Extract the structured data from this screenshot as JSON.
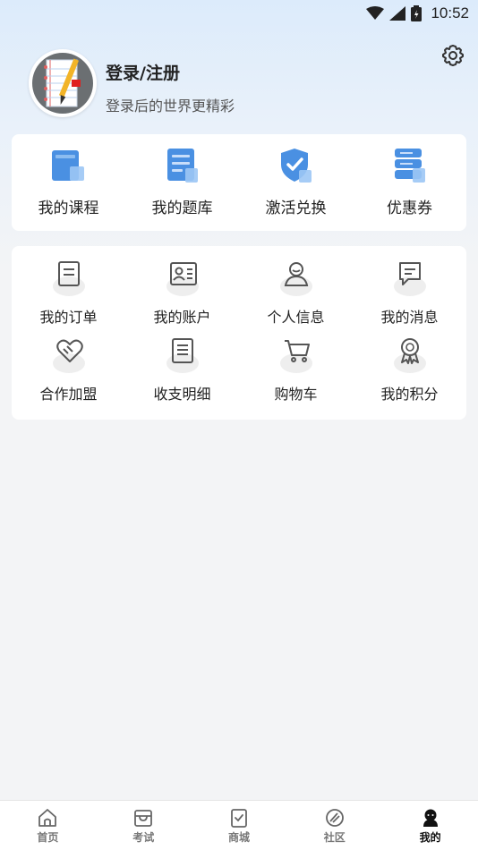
{
  "status_bar": {
    "time": "10:52"
  },
  "profile": {
    "title": "登录/注册",
    "subtitle": "登录后的世界更精彩"
  },
  "top_menu": [
    {
      "label": "我的课程",
      "icon": "course-icon"
    },
    {
      "label": "我的题库",
      "icon": "question-bank-icon"
    },
    {
      "label": "激活兑换",
      "icon": "shield-check-icon"
    },
    {
      "label": "优惠券",
      "icon": "coupon-icon"
    }
  ],
  "grid_menu": [
    {
      "label": "我的订单",
      "icon": "order-icon"
    },
    {
      "label": "我的账户",
      "icon": "account-card-icon"
    },
    {
      "label": "个人信息",
      "icon": "person-icon"
    },
    {
      "label": "我的消息",
      "icon": "message-icon"
    },
    {
      "label": "合作加盟",
      "icon": "handshake-heart-icon"
    },
    {
      "label": "收支明细",
      "icon": "ledger-icon"
    },
    {
      "label": "购物车",
      "icon": "cart-icon"
    },
    {
      "label": "我的积分",
      "icon": "award-icon"
    }
  ],
  "bottom_nav": [
    {
      "label": "首页",
      "icon": "home-icon"
    },
    {
      "label": "考试",
      "icon": "exam-icon"
    },
    {
      "label": "商城",
      "icon": "mall-icon"
    },
    {
      "label": "社区",
      "icon": "community-icon"
    },
    {
      "label": "我的",
      "icon": "me-icon",
      "active": true
    }
  ],
  "colors": {
    "accent_blue": "#4a90e2",
    "light_blue": "#9cc7f5",
    "icon_gray": "#555555"
  }
}
